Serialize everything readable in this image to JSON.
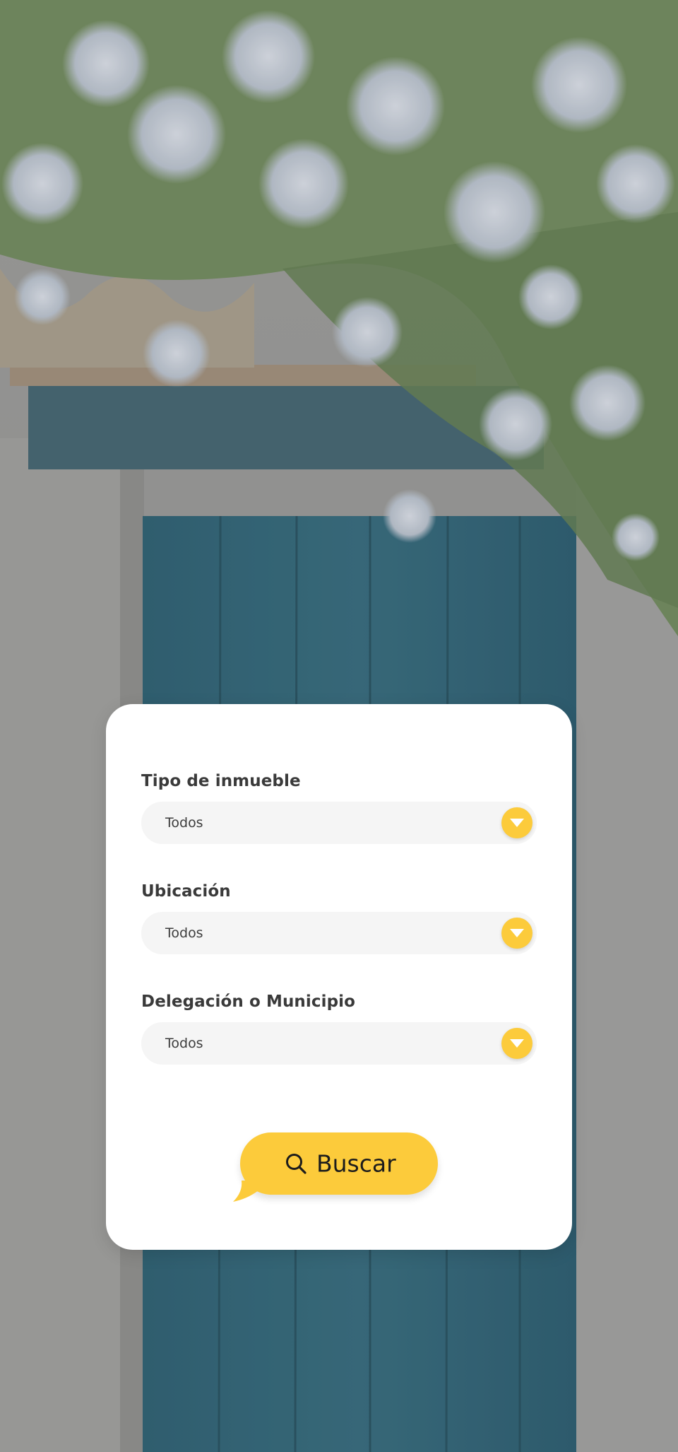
{
  "background": {
    "description_icon": "garden-door-photo"
  },
  "form": {
    "fields": [
      {
        "label": "Tipo de inmueble",
        "value": "Todos"
      },
      {
        "label": "Ubicación",
        "value": "Todos"
      },
      {
        "label": "Delegación o Municipio",
        "value": "Todos"
      }
    ],
    "search_button_label": "Buscar",
    "dropdown_icon": "chevron-down-icon",
    "search_icon": "search-icon"
  },
  "colors": {
    "accent": "#fccb3b",
    "door": "#2b6276",
    "card": "#ffffff",
    "field_bg": "#f5f5f5"
  }
}
